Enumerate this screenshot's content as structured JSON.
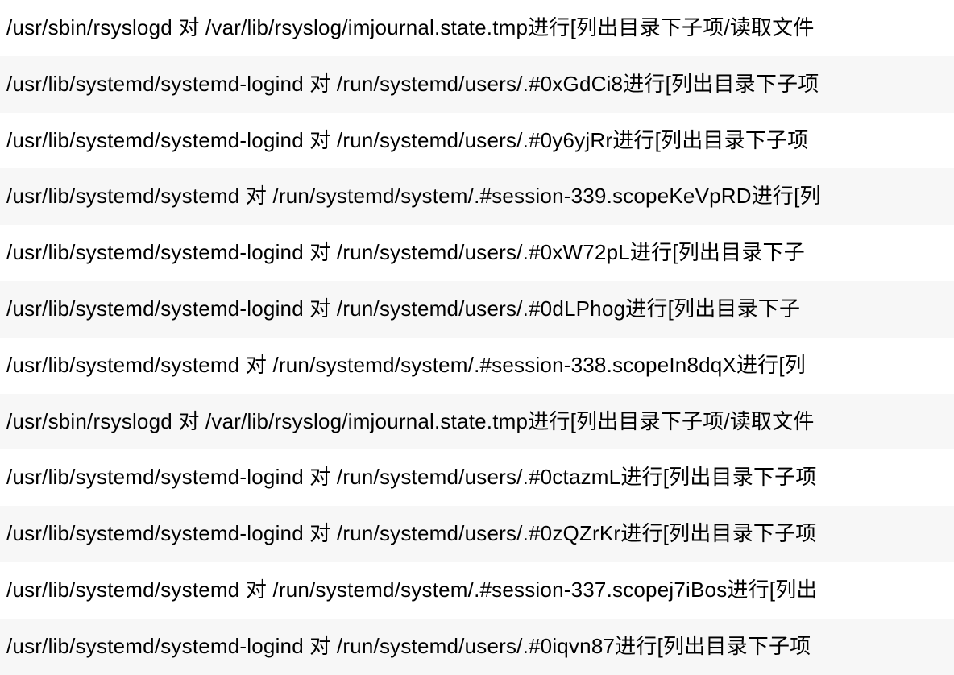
{
  "logs": [
    {
      "text": "/usr/sbin/rsyslogd 对 /var/lib/rsyslog/imjournal.state.tmp进行[列出目录下子项/读取文件"
    },
    {
      "text": "/usr/lib/systemd/systemd-logind 对 /run/systemd/users/.#0xGdCi8进行[列出目录下子项"
    },
    {
      "text": "/usr/lib/systemd/systemd-logind 对 /run/systemd/users/.#0y6yjRr进行[列出目录下子项"
    },
    {
      "text": "/usr/lib/systemd/systemd 对 /run/systemd/system/.#session-339.scopeKeVpRD进行[列"
    },
    {
      "text": "/usr/lib/systemd/systemd-logind 对 /run/systemd/users/.#0xW72pL进行[列出目录下子"
    },
    {
      "text": "/usr/lib/systemd/systemd-logind 对 /run/systemd/users/.#0dLPhog进行[列出目录下子"
    },
    {
      "text": "/usr/lib/systemd/systemd 对 /run/systemd/system/.#session-338.scopeIn8dqX进行[列"
    },
    {
      "text": "/usr/sbin/rsyslogd 对 /var/lib/rsyslog/imjournal.state.tmp进行[列出目录下子项/读取文件"
    },
    {
      "text": "/usr/lib/systemd/systemd-logind 对 /run/systemd/users/.#0ctazmL进行[列出目录下子项"
    },
    {
      "text": "/usr/lib/systemd/systemd-logind 对 /run/systemd/users/.#0zQZrKr进行[列出目录下子项"
    },
    {
      "text": "/usr/lib/systemd/systemd 对 /run/systemd/system/.#session-337.scopej7iBos进行[列出"
    },
    {
      "text": "/usr/lib/systemd/systemd-logind 对 /run/systemd/users/.#0iqvn87进行[列出目录下子项"
    }
  ]
}
